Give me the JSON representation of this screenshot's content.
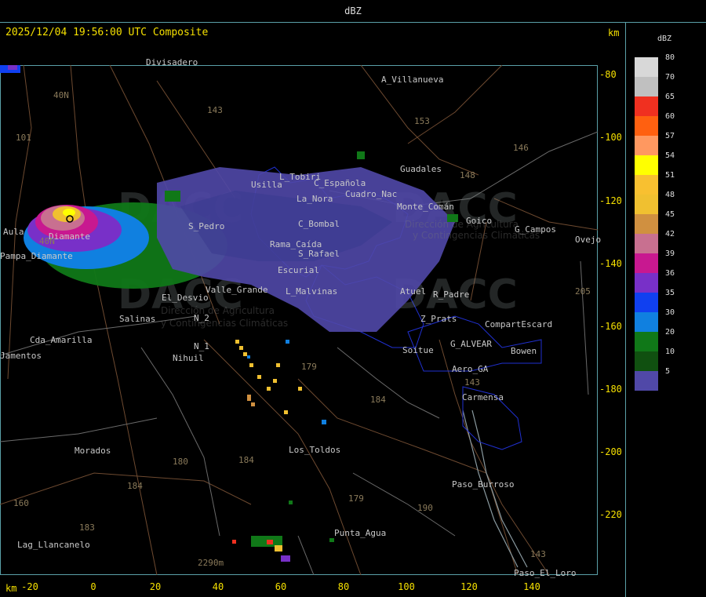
{
  "header": {
    "title": "dBZ"
  },
  "map": {
    "timestamp": "2025/12/04 19:56:00 UTC Composite",
    "km_label": "km",
    "x_ticks": [
      "-20",
      "0",
      "20",
      "40",
      "60",
      "80",
      "100",
      "120",
      "140"
    ],
    "y_ticks": [
      "-80",
      "-100",
      "-120",
      "-140",
      "-160",
      "-180",
      "-200",
      "-220"
    ],
    "places": [
      {
        "name": "Divisadero"
      },
      {
        "name": "A_Villanueva"
      },
      {
        "name": "Guadales"
      },
      {
        "name": "L_Tobiri"
      },
      {
        "name": "C_Española"
      },
      {
        "name": "La_Nora"
      },
      {
        "name": "Usilla"
      },
      {
        "name": "C_Bombal"
      },
      {
        "name": "Rama_Caída"
      },
      {
        "name": "S_Pedro"
      },
      {
        "name": "S_Rafael"
      },
      {
        "name": "Escurial"
      },
      {
        "name": "El_Desvio"
      },
      {
        "name": "Valle_Grande"
      },
      {
        "name": "Salinas"
      },
      {
        "name": "Pampa_Diamante"
      },
      {
        "name": "Diamante"
      },
      {
        "name": "Cda_Amarilla"
      },
      {
        "name": "N_1"
      },
      {
        "name": "N_2"
      },
      {
        "name": "Nihuil"
      },
      {
        "name": "Morados"
      },
      {
        "name": "Los_Toldos"
      },
      {
        "name": "Punta_Agua"
      },
      {
        "name": "Lag_Llancanelo"
      },
      {
        "name": "Paso_Burroso"
      },
      {
        "name": "Paso_El_Loro"
      },
      {
        "name": "Carmensa"
      },
      {
        "name": "Aero_GA"
      },
      {
        "name": "G_ALVEAR"
      },
      {
        "name": "Soitue"
      },
      {
        "name": "Bowen"
      },
      {
        "name": "CompartEscard"
      },
      {
        "name": "Z_Prats"
      },
      {
        "name": "R_Padre"
      },
      {
        "name": "G_Campos"
      },
      {
        "name": "Goico"
      },
      {
        "name": "Cuadro_Nac"
      },
      {
        "name": "Atuel"
      },
      {
        "name": "L_Malvinas"
      },
      {
        "name": "Aula"
      },
      {
        "name": "Jamentos"
      },
      {
        "name": "Ovejo"
      },
      {
        "name": "Monte_Comán"
      }
    ],
    "routes": [
      "40N",
      "101",
      "143",
      "153",
      "146",
      "148",
      "40N",
      "179",
      "184",
      "180",
      "184",
      "183",
      "184",
      "179",
      "190",
      "143",
      "143",
      "205",
      "160",
      "2290m"
    ],
    "watermark": {
      "logo": "DACC",
      "sub1": "Dirección de Agricultura",
      "sub2": "y Contingencias Climáticas"
    }
  },
  "legend": {
    "title": "dBZ",
    "levels": [
      {
        "label": "80",
        "color": "#d8d8d8"
      },
      {
        "label": "70",
        "color": "#c0c0c0"
      },
      {
        "label": "65",
        "color": "#f03020"
      },
      {
        "label": "60",
        "color": "#ff6010"
      },
      {
        "label": "57",
        "color": "#ff9860"
      },
      {
        "label": "54",
        "color": "#ffff00"
      },
      {
        "label": "51",
        "color": "#f8c030"
      },
      {
        "label": "48",
        "color": "#f0c030"
      },
      {
        "label": "45",
        "color": "#d09040"
      },
      {
        "label": "42",
        "color": "#c87090"
      },
      {
        "label": "39",
        "color": "#c81890"
      },
      {
        "label": "36",
        "color": "#7830c8"
      },
      {
        "label": "35",
        "color": "#1040f0"
      },
      {
        "label": "30",
        "color": "#1080e0"
      },
      {
        "label": "20",
        "color": "#107818"
      },
      {
        "label": "10",
        "color": "#105010"
      },
      {
        "label": "5",
        "color": "#5048a8"
      }
    ]
  }
}
